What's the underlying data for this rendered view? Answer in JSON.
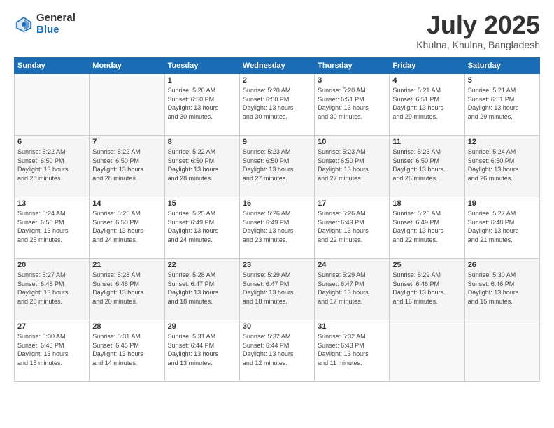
{
  "logo": {
    "general": "General",
    "blue": "Blue"
  },
  "title": {
    "month": "July 2025",
    "location": "Khulna, Khulna, Bangladesh"
  },
  "headers": [
    "Sunday",
    "Monday",
    "Tuesday",
    "Wednesday",
    "Thursday",
    "Friday",
    "Saturday"
  ],
  "weeks": [
    [
      {
        "day": "",
        "info": ""
      },
      {
        "day": "",
        "info": ""
      },
      {
        "day": "1",
        "info": "Sunrise: 5:20 AM\nSunset: 6:50 PM\nDaylight: 13 hours\nand 30 minutes."
      },
      {
        "day": "2",
        "info": "Sunrise: 5:20 AM\nSunset: 6:50 PM\nDaylight: 13 hours\nand 30 minutes."
      },
      {
        "day": "3",
        "info": "Sunrise: 5:20 AM\nSunset: 6:51 PM\nDaylight: 13 hours\nand 30 minutes."
      },
      {
        "day": "4",
        "info": "Sunrise: 5:21 AM\nSunset: 6:51 PM\nDaylight: 13 hours\nand 29 minutes."
      },
      {
        "day": "5",
        "info": "Sunrise: 5:21 AM\nSunset: 6:51 PM\nDaylight: 13 hours\nand 29 minutes."
      }
    ],
    [
      {
        "day": "6",
        "info": "Sunrise: 5:22 AM\nSunset: 6:50 PM\nDaylight: 13 hours\nand 28 minutes."
      },
      {
        "day": "7",
        "info": "Sunrise: 5:22 AM\nSunset: 6:50 PM\nDaylight: 13 hours\nand 28 minutes."
      },
      {
        "day": "8",
        "info": "Sunrise: 5:22 AM\nSunset: 6:50 PM\nDaylight: 13 hours\nand 28 minutes."
      },
      {
        "day": "9",
        "info": "Sunrise: 5:23 AM\nSunset: 6:50 PM\nDaylight: 13 hours\nand 27 minutes."
      },
      {
        "day": "10",
        "info": "Sunrise: 5:23 AM\nSunset: 6:50 PM\nDaylight: 13 hours\nand 27 minutes."
      },
      {
        "day": "11",
        "info": "Sunrise: 5:23 AM\nSunset: 6:50 PM\nDaylight: 13 hours\nand 26 minutes."
      },
      {
        "day": "12",
        "info": "Sunrise: 5:24 AM\nSunset: 6:50 PM\nDaylight: 13 hours\nand 26 minutes."
      }
    ],
    [
      {
        "day": "13",
        "info": "Sunrise: 5:24 AM\nSunset: 6:50 PM\nDaylight: 13 hours\nand 25 minutes."
      },
      {
        "day": "14",
        "info": "Sunrise: 5:25 AM\nSunset: 6:50 PM\nDaylight: 13 hours\nand 24 minutes."
      },
      {
        "day": "15",
        "info": "Sunrise: 5:25 AM\nSunset: 6:49 PM\nDaylight: 13 hours\nand 24 minutes."
      },
      {
        "day": "16",
        "info": "Sunrise: 5:26 AM\nSunset: 6:49 PM\nDaylight: 13 hours\nand 23 minutes."
      },
      {
        "day": "17",
        "info": "Sunrise: 5:26 AM\nSunset: 6:49 PM\nDaylight: 13 hours\nand 22 minutes."
      },
      {
        "day": "18",
        "info": "Sunrise: 5:26 AM\nSunset: 6:49 PM\nDaylight: 13 hours\nand 22 minutes."
      },
      {
        "day": "19",
        "info": "Sunrise: 5:27 AM\nSunset: 6:48 PM\nDaylight: 13 hours\nand 21 minutes."
      }
    ],
    [
      {
        "day": "20",
        "info": "Sunrise: 5:27 AM\nSunset: 6:48 PM\nDaylight: 13 hours\nand 20 minutes."
      },
      {
        "day": "21",
        "info": "Sunrise: 5:28 AM\nSunset: 6:48 PM\nDaylight: 13 hours\nand 20 minutes."
      },
      {
        "day": "22",
        "info": "Sunrise: 5:28 AM\nSunset: 6:47 PM\nDaylight: 13 hours\nand 18 minutes."
      },
      {
        "day": "23",
        "info": "Sunrise: 5:29 AM\nSunset: 6:47 PM\nDaylight: 13 hours\nand 18 minutes."
      },
      {
        "day": "24",
        "info": "Sunrise: 5:29 AM\nSunset: 6:47 PM\nDaylight: 13 hours\nand 17 minutes."
      },
      {
        "day": "25",
        "info": "Sunrise: 5:29 AM\nSunset: 6:46 PM\nDaylight: 13 hours\nand 16 minutes."
      },
      {
        "day": "26",
        "info": "Sunrise: 5:30 AM\nSunset: 6:46 PM\nDaylight: 13 hours\nand 15 minutes."
      }
    ],
    [
      {
        "day": "27",
        "info": "Sunrise: 5:30 AM\nSunset: 6:45 PM\nDaylight: 13 hours\nand 15 minutes."
      },
      {
        "day": "28",
        "info": "Sunrise: 5:31 AM\nSunset: 6:45 PM\nDaylight: 13 hours\nand 14 minutes."
      },
      {
        "day": "29",
        "info": "Sunrise: 5:31 AM\nSunset: 6:44 PM\nDaylight: 13 hours\nand 13 minutes."
      },
      {
        "day": "30",
        "info": "Sunrise: 5:32 AM\nSunset: 6:44 PM\nDaylight: 13 hours\nand 12 minutes."
      },
      {
        "day": "31",
        "info": "Sunrise: 5:32 AM\nSunset: 6:43 PM\nDaylight: 13 hours\nand 11 minutes."
      },
      {
        "day": "",
        "info": ""
      },
      {
        "day": "",
        "info": ""
      }
    ]
  ]
}
